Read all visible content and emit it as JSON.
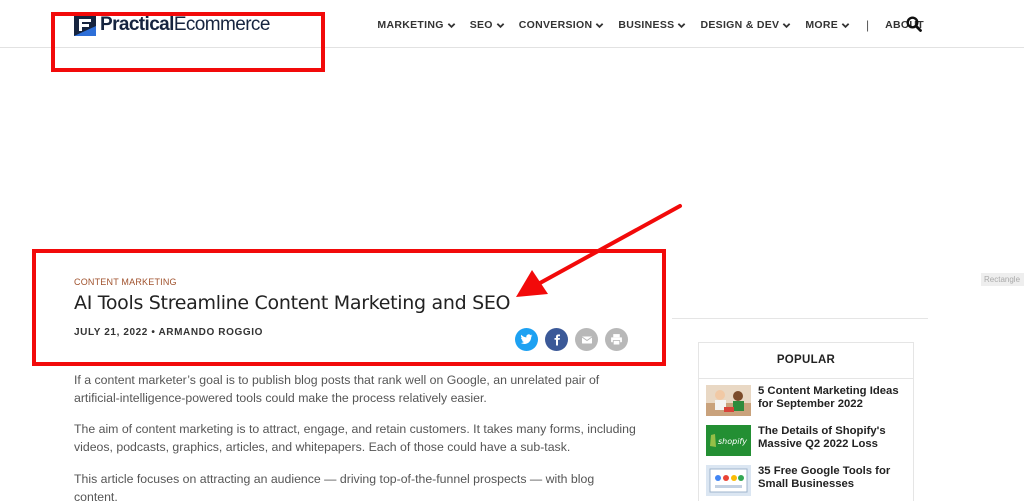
{
  "header": {
    "logo_text_bold": "Practical",
    "logo_text_rest": "Ecommerce",
    "nav": [
      {
        "label": "MARKETING"
      },
      {
        "label": "SEO"
      },
      {
        "label": "CONVERSION"
      },
      {
        "label": "BUSINESS"
      },
      {
        "label": "DESIGN & DEV"
      },
      {
        "label": "MORE"
      }
    ],
    "separator": "|",
    "about_label": "ABOUT"
  },
  "ad_tag": "Rectangle",
  "article": {
    "category": "CONTENT MARKETING",
    "title": "AI Tools Streamline Content Marketing and SEO",
    "byline": "JULY 21, 2022 • ARMANDO ROGGIO",
    "share_icons": [
      "twitter-icon",
      "facebook-icon",
      "email-icon",
      "print-icon"
    ],
    "paragraphs": [
      "If a content marketer’s goal is to publish blog posts that rank well on Google, an unrelated pair of artificial-intelligence-powered tools could make the process relatively easier.",
      "The aim of content marketing is to attract, engage, and retain customers. It takes many forms, including videos, podcasts, graphics, articles, and whitepapers. Each of those could have a sub-task.",
      "This article focuses on attracting an audience — driving top-of-the-funnel prospects — with blog content."
    ]
  },
  "sidebar": {
    "title": "POPULAR",
    "items": [
      {
        "title": "5 Content Marketing Ideas for September 2022"
      },
      {
        "title": "The Details of Shopify's Massive Q2 2022 Loss",
        "thumb_text": "shopify"
      },
      {
        "title": "35 Free Google Tools for Small Businesses"
      }
    ]
  },
  "colors": {
    "annotation_red": "#f20a0a",
    "twitter": "#1da1f2",
    "facebook": "#3b5998",
    "category": "#a0522d",
    "logo_navy": "#16243f"
  }
}
